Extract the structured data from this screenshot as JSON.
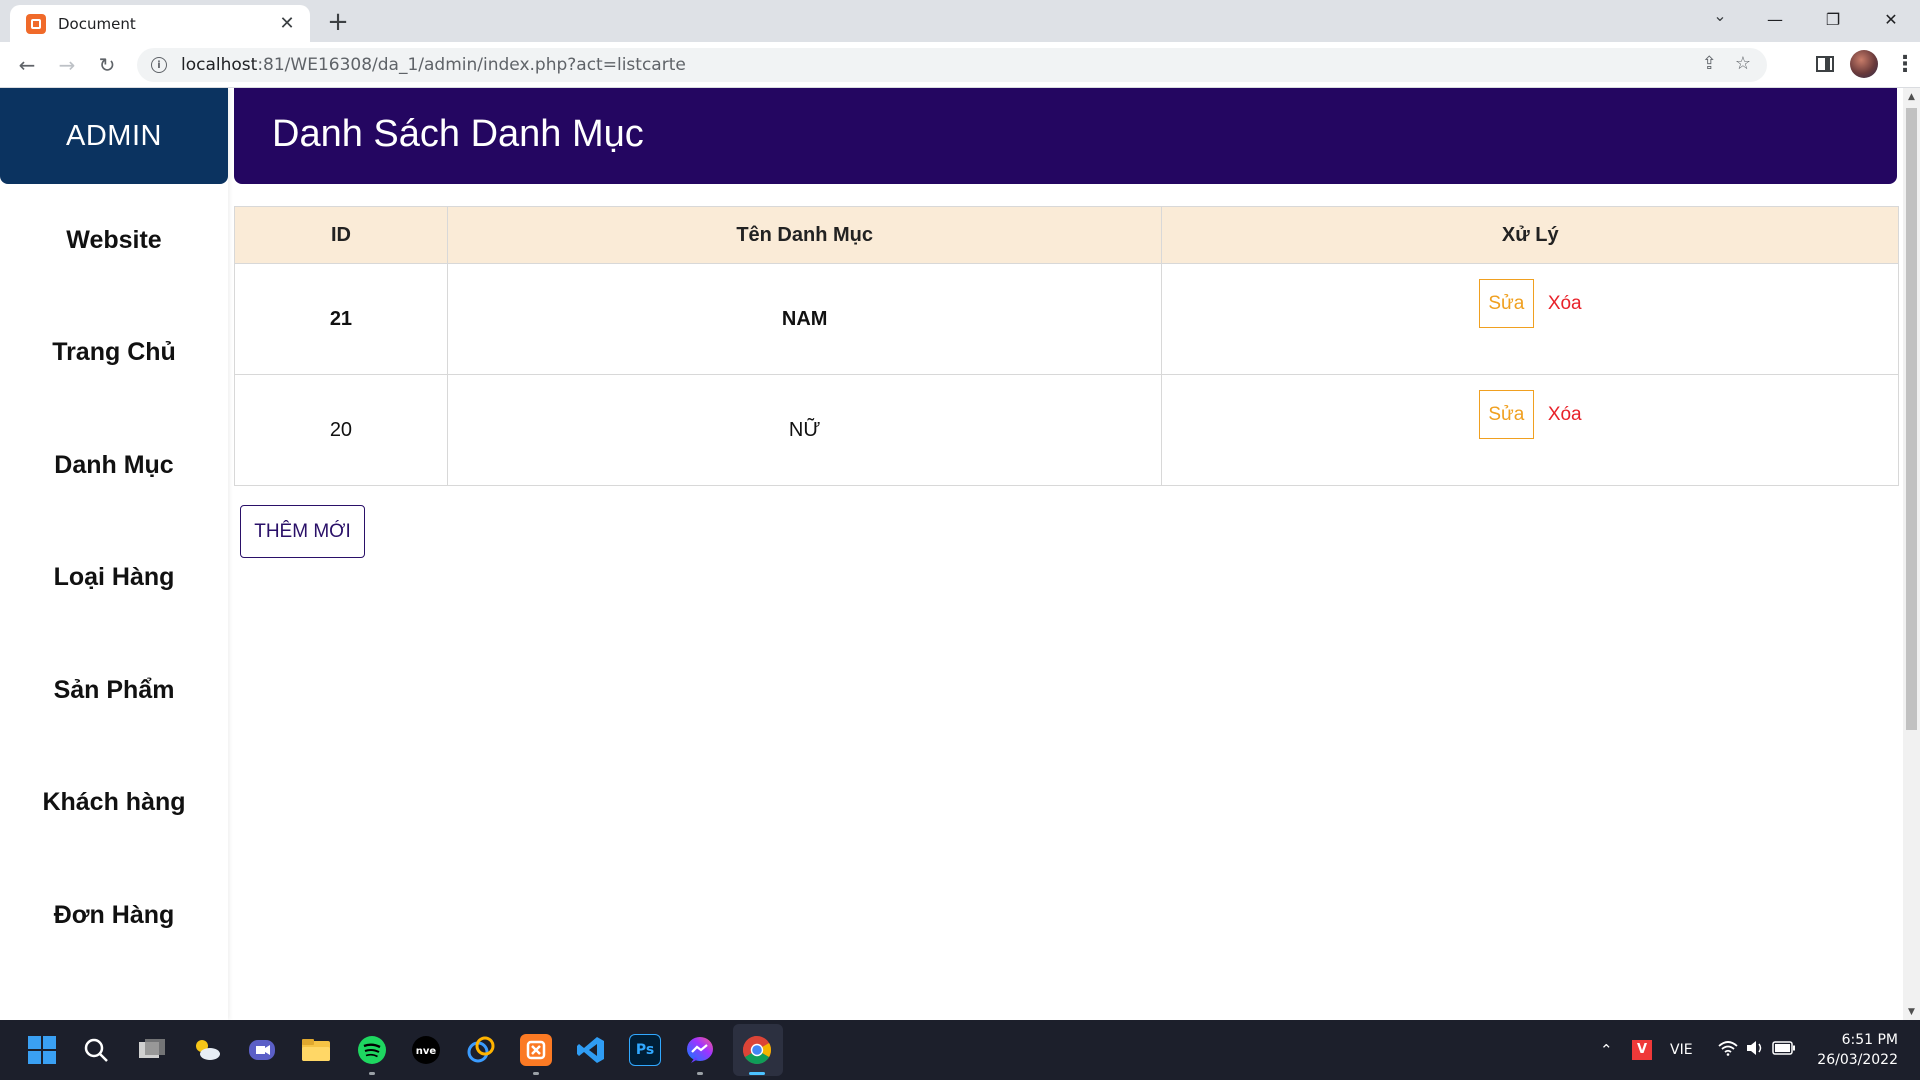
{
  "browser": {
    "tab_title": "Document",
    "new_tab": "+",
    "tab_close": "✕",
    "tab_list": "⌄",
    "url_host": "localhost",
    "url_path": ":81/WE16308/da_1/admin/index.php?act=listcarte",
    "window": {
      "minimize": "—",
      "restore": "❐",
      "close": "✕"
    }
  },
  "sidebar": {
    "title": "ADMIN",
    "items": [
      {
        "label": "Website"
      },
      {
        "label": "Trang Chủ"
      },
      {
        "label": "Danh Mục"
      },
      {
        "label": "Loại Hàng"
      },
      {
        "label": "Sản Phẩm"
      },
      {
        "label": "Khách hàng"
      },
      {
        "label": "Đơn Hàng"
      }
    ]
  },
  "header": {
    "title": "Danh Sách Danh Mục"
  },
  "table": {
    "columns": [
      "ID",
      "Tên Danh Mục",
      "Xử Lý"
    ],
    "rows": [
      {
        "id": "21",
        "name": "NAM",
        "edit": "Sửa",
        "delete": "Xóa"
      },
      {
        "id": "20",
        "name": "NỮ",
        "edit": "Sửa",
        "delete": "Xóa"
      }
    ]
  },
  "add_button": "THÊM MỚI",
  "taskbar": {
    "language": "VIE",
    "time": "6:51 PM",
    "date": "26/03/2022",
    "apps": [
      "start",
      "search",
      "task-view",
      "weather",
      "teams",
      "file-explorer",
      "spotify",
      "nve",
      "app-blue",
      "xampp",
      "vscode",
      "photoshop",
      "messenger",
      "chrome"
    ]
  },
  "colors": {
    "admin_bg": "#0b3360",
    "header_bg": "#240661",
    "table_head_bg": "#faebd7",
    "edit": "#f0a020",
    "delete": "#e8222a"
  }
}
